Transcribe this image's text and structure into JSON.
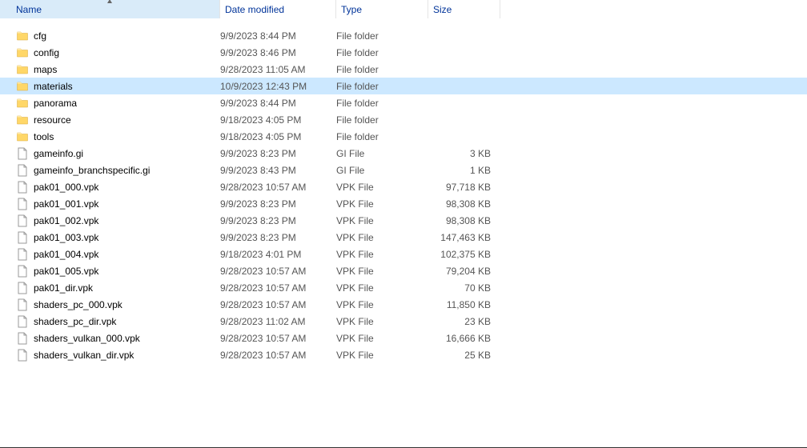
{
  "columns": {
    "name": "Name",
    "date": "Date modified",
    "type": "Type",
    "size": "Size"
  },
  "sort": {
    "column": "name",
    "direction": "asc"
  },
  "files": [
    {
      "name": "cfg",
      "date": "9/9/2023 8:44 PM",
      "type": "File folder",
      "size": "",
      "icon": "folder"
    },
    {
      "name": "config",
      "date": "9/9/2023 8:46 PM",
      "type": "File folder",
      "size": "",
      "icon": "folder"
    },
    {
      "name": "maps",
      "date": "9/28/2023 11:05 AM",
      "type": "File folder",
      "size": "",
      "icon": "folder"
    },
    {
      "name": "materials",
      "date": "10/9/2023 12:43 PM",
      "type": "File folder",
      "size": "",
      "icon": "folder",
      "selected": true
    },
    {
      "name": "panorama",
      "date": "9/9/2023 8:44 PM",
      "type": "File folder",
      "size": "",
      "icon": "folder"
    },
    {
      "name": "resource",
      "date": "9/18/2023 4:05 PM",
      "type": "File folder",
      "size": "",
      "icon": "folder"
    },
    {
      "name": "tools",
      "date": "9/18/2023 4:05 PM",
      "type": "File folder",
      "size": "",
      "icon": "folder"
    },
    {
      "name": "gameinfo.gi",
      "date": "9/9/2023 8:23 PM",
      "type": "GI File",
      "size": "3 KB",
      "icon": "file"
    },
    {
      "name": "gameinfo_branchspecific.gi",
      "date": "9/9/2023 8:43 PM",
      "type": "GI File",
      "size": "1 KB",
      "icon": "file"
    },
    {
      "name": "pak01_000.vpk",
      "date": "9/28/2023 10:57 AM",
      "type": "VPK File",
      "size": "97,718 KB",
      "icon": "file"
    },
    {
      "name": "pak01_001.vpk",
      "date": "9/9/2023 8:23 PM",
      "type": "VPK File",
      "size": "98,308 KB",
      "icon": "file"
    },
    {
      "name": "pak01_002.vpk",
      "date": "9/9/2023 8:23 PM",
      "type": "VPK File",
      "size": "98,308 KB",
      "icon": "file"
    },
    {
      "name": "pak01_003.vpk",
      "date": "9/9/2023 8:23 PM",
      "type": "VPK File",
      "size": "147,463 KB",
      "icon": "file"
    },
    {
      "name": "pak01_004.vpk",
      "date": "9/18/2023 4:01 PM",
      "type": "VPK File",
      "size": "102,375 KB",
      "icon": "file"
    },
    {
      "name": "pak01_005.vpk",
      "date": "9/28/2023 10:57 AM",
      "type": "VPK File",
      "size": "79,204 KB",
      "icon": "file"
    },
    {
      "name": "pak01_dir.vpk",
      "date": "9/28/2023 10:57 AM",
      "type": "VPK File",
      "size": "70 KB",
      "icon": "file"
    },
    {
      "name": "shaders_pc_000.vpk",
      "date": "9/28/2023 10:57 AM",
      "type": "VPK File",
      "size": "11,850 KB",
      "icon": "file"
    },
    {
      "name": "shaders_pc_dir.vpk",
      "date": "9/28/2023 11:02 AM",
      "type": "VPK File",
      "size": "23 KB",
      "icon": "file"
    },
    {
      "name": "shaders_vulkan_000.vpk",
      "date": "9/28/2023 10:57 AM",
      "type": "VPK File",
      "size": "16,666 KB",
      "icon": "file"
    },
    {
      "name": "shaders_vulkan_dir.vpk",
      "date": "9/28/2023 10:57 AM",
      "type": "VPK File",
      "size": "25 KB",
      "icon": "file"
    }
  ]
}
